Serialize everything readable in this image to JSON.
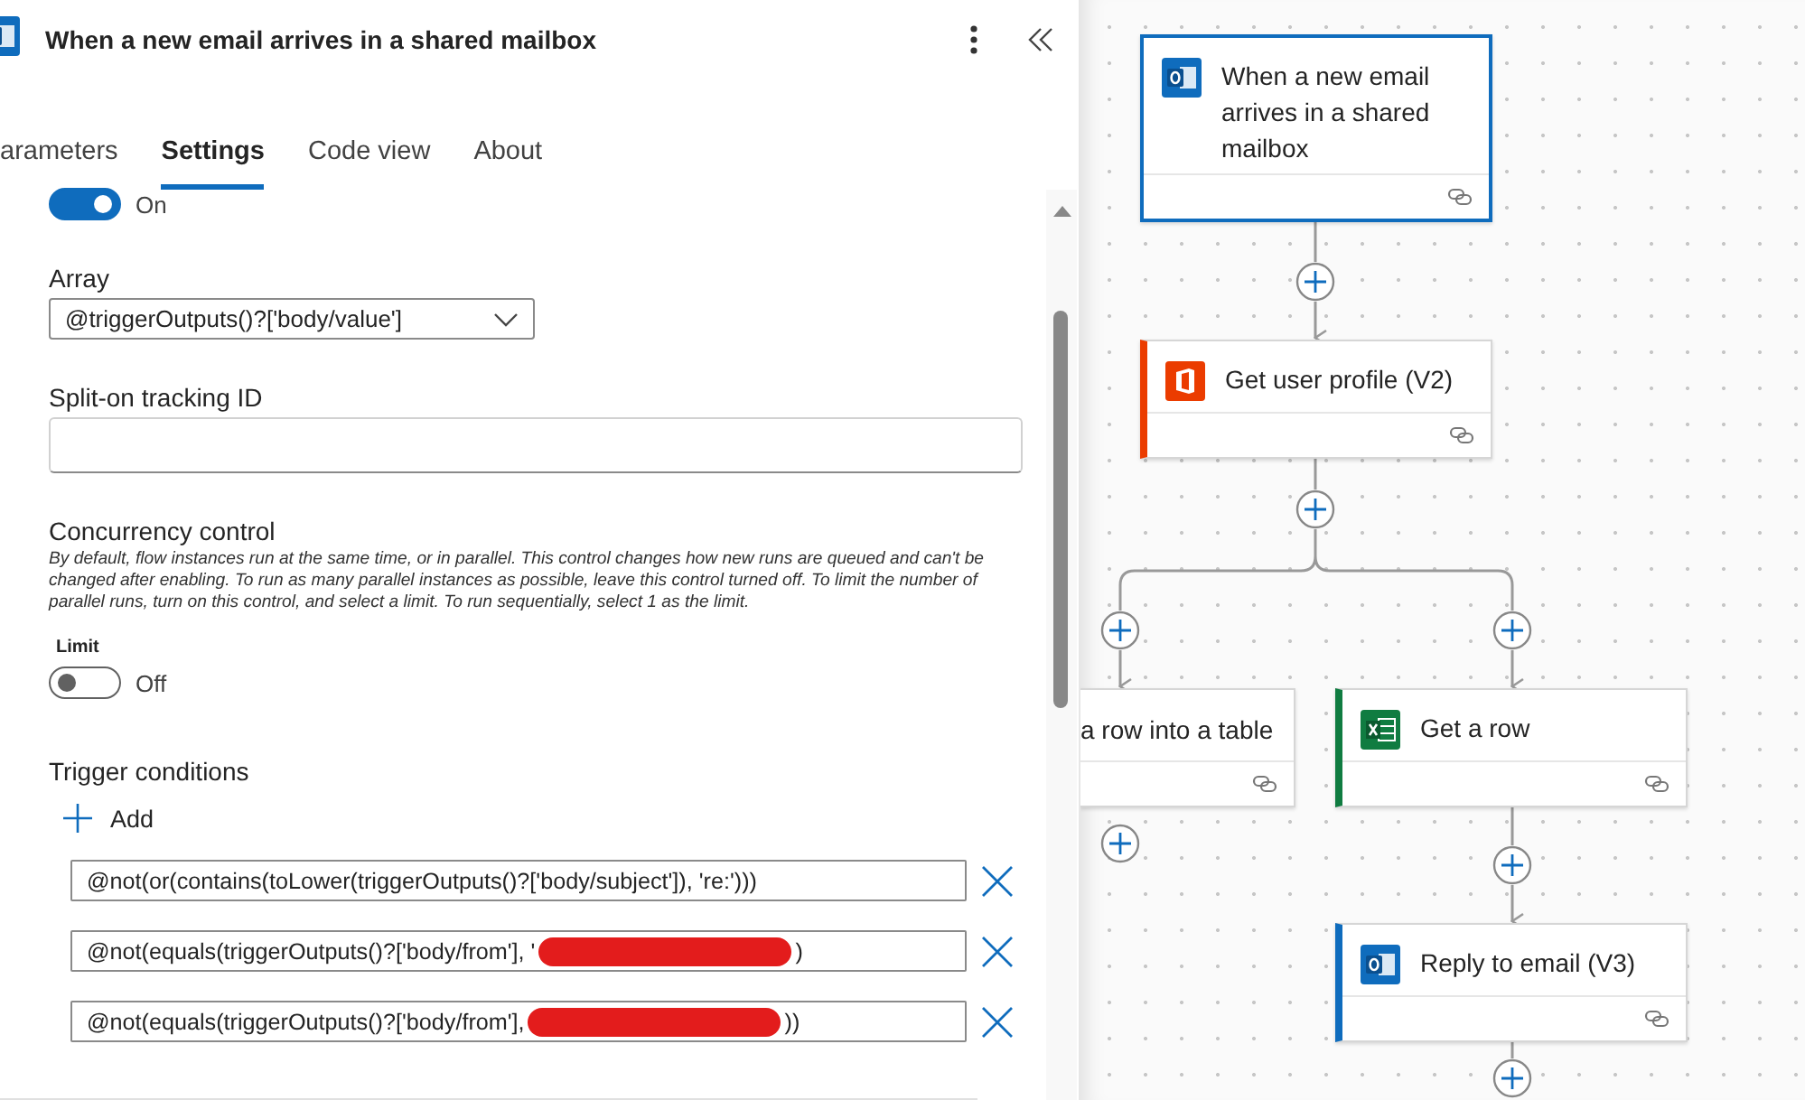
{
  "panel": {
    "title": "When a new email arrives in a shared mailbox",
    "tabs": [
      {
        "label": "arameters",
        "selected": false
      },
      {
        "label": "Settings",
        "selected": true
      },
      {
        "label": "Code view",
        "selected": false
      },
      {
        "label": "About",
        "selected": false
      }
    ],
    "split_on": {
      "on": true,
      "label": "On"
    },
    "array": {
      "label": "Array",
      "value": "@triggerOutputs()?['body/value']"
    },
    "tracking_id": {
      "label": "Split-on tracking ID"
    },
    "concurrency": {
      "heading": "Concurrency control",
      "description": "By default, flow instances run at the same time, or in parallel. This control changes how new runs are queued and can't be changed after enabling. To run as many parallel instances as possible, leave this control turned off. To limit the number of parallel runs, turn on this control, and select a limit. To run sequentially, select 1 as the limit.",
      "limit_label": "Limit",
      "toggle": {
        "on": false,
        "label": "Off"
      }
    },
    "trigger_conditions": {
      "heading": "Trigger conditions",
      "add_label": "Add",
      "conditions": [
        {
          "text": "@not(or(contains(toLower(triggerOutputs()?['body/subject']), 're:')))",
          "redacted": false
        },
        {
          "text": "@not(equals(triggerOutputs()?['body/from'], '",
          "redacted": true,
          "tail": ")"
        },
        {
          "text": "@not(equals(triggerOutputs()?['body/from'],",
          "redacted": true,
          "tail": "))"
        }
      ]
    }
  },
  "canvas": {
    "nodes": [
      {
        "title": "When a new email arrives in a shared mailbox",
        "kind": "mail",
        "color": "#0f6cbd",
        "selected": true
      },
      {
        "title": "Get user profile (V2)",
        "kind": "office",
        "color": "#eb3c00",
        "selected": false
      },
      {
        "title": "a row into a table",
        "kind": "cut",
        "selected": false
      },
      {
        "title": "Get a row",
        "kind": "sheet",
        "color": "#107c41",
        "selected": false
      },
      {
        "title": "Reply to email (V3)",
        "kind": "mail",
        "color": "#0f6cbd",
        "selected": false
      }
    ]
  }
}
